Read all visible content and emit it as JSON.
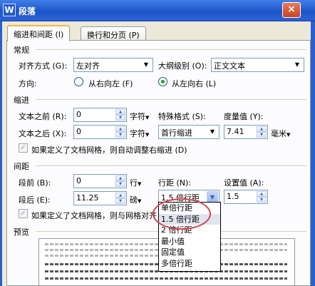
{
  "window": {
    "title": "段落",
    "app_icon_letter": "W",
    "close_label": "×"
  },
  "tabs": [
    {
      "label": "缩进和间距 (I)",
      "active": true
    },
    {
      "label": "换行和分页 (P)",
      "active": false
    }
  ],
  "general": {
    "section": "常规",
    "alignment_label": "对齐方式 (G):",
    "alignment_value": "左对齐",
    "outline_label": "大纲级别 (O):",
    "outline_value": "正文文本",
    "direction_label": "方向:",
    "rtl_label": "从右向左 (F)",
    "ltr_label": "从左向右 (L)"
  },
  "indent": {
    "section": "缩进",
    "before_label": "文本之前 (R):",
    "before_value": "0",
    "before_unit": "字符",
    "after_label": "文本之后 (X):",
    "after_value": "0",
    "after_unit": "字符",
    "special_label": "特殊格式 (S):",
    "special_value": "首行缩进",
    "measure_label": "度量值 (Y):",
    "measure_value": "7.41",
    "measure_unit": "毫米",
    "grid_check_label": "如果定义了文档网格，则自动调整右缩进 (D)"
  },
  "spacing": {
    "section": "间距",
    "before_label": "段前 (B):",
    "before_value": "0",
    "before_unit": "行",
    "after_label": "段后 (E):",
    "after_value": "11.25",
    "after_unit": "磅",
    "line_label": "行距 (N):",
    "line_value": "1.5 倍行距",
    "setting_label": "设置值 (A):",
    "setting_value": "1.5",
    "grid_check_label": "如果定义了文档网格，则与网格对齐"
  },
  "line_spacing_options": [
    "单倍行距",
    "1.5 倍行距",
    "2 倍行距",
    "最小值",
    "固定值",
    "多倍行距"
  ],
  "line_spacing_selected": "1.5 倍行距",
  "preview": {
    "section": "预览"
  },
  "icons": {
    "dropdown_arrow": "▼",
    "spin_up": "▲",
    "spin_down": "▼",
    "check": "✓"
  },
  "colors": {
    "title_bar": "#1f55c8",
    "highlight_ellipse": "#d6434f",
    "tab_accent": "#f5b83b"
  }
}
